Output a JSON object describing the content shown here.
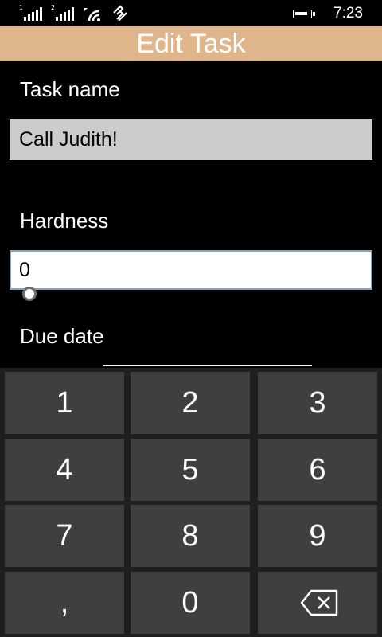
{
  "status_bar": {
    "sim1": "1",
    "sim2": "2",
    "time": "7:23",
    "icons": [
      "signal-sim1-icon",
      "signal-sim2-icon",
      "wifi-icon",
      "data-sync-icon",
      "battery-icon"
    ]
  },
  "title": "Edit Task",
  "form": {
    "task_name_label": "Task name",
    "task_name_value": "Call Judith!",
    "hardness_label": "Hardness",
    "hardness_value": "0",
    "due_date_label": "Due date"
  },
  "keypad": {
    "keys": [
      "1",
      "2",
      "3",
      "4",
      "5",
      "6",
      "7",
      "8",
      "9",
      ",",
      "0"
    ],
    "backspace_icon": "backspace-icon"
  },
  "colors": {
    "title_bar": "#dfb68c",
    "key": "#3f3f3f",
    "readonly_input": "#cccccc"
  }
}
